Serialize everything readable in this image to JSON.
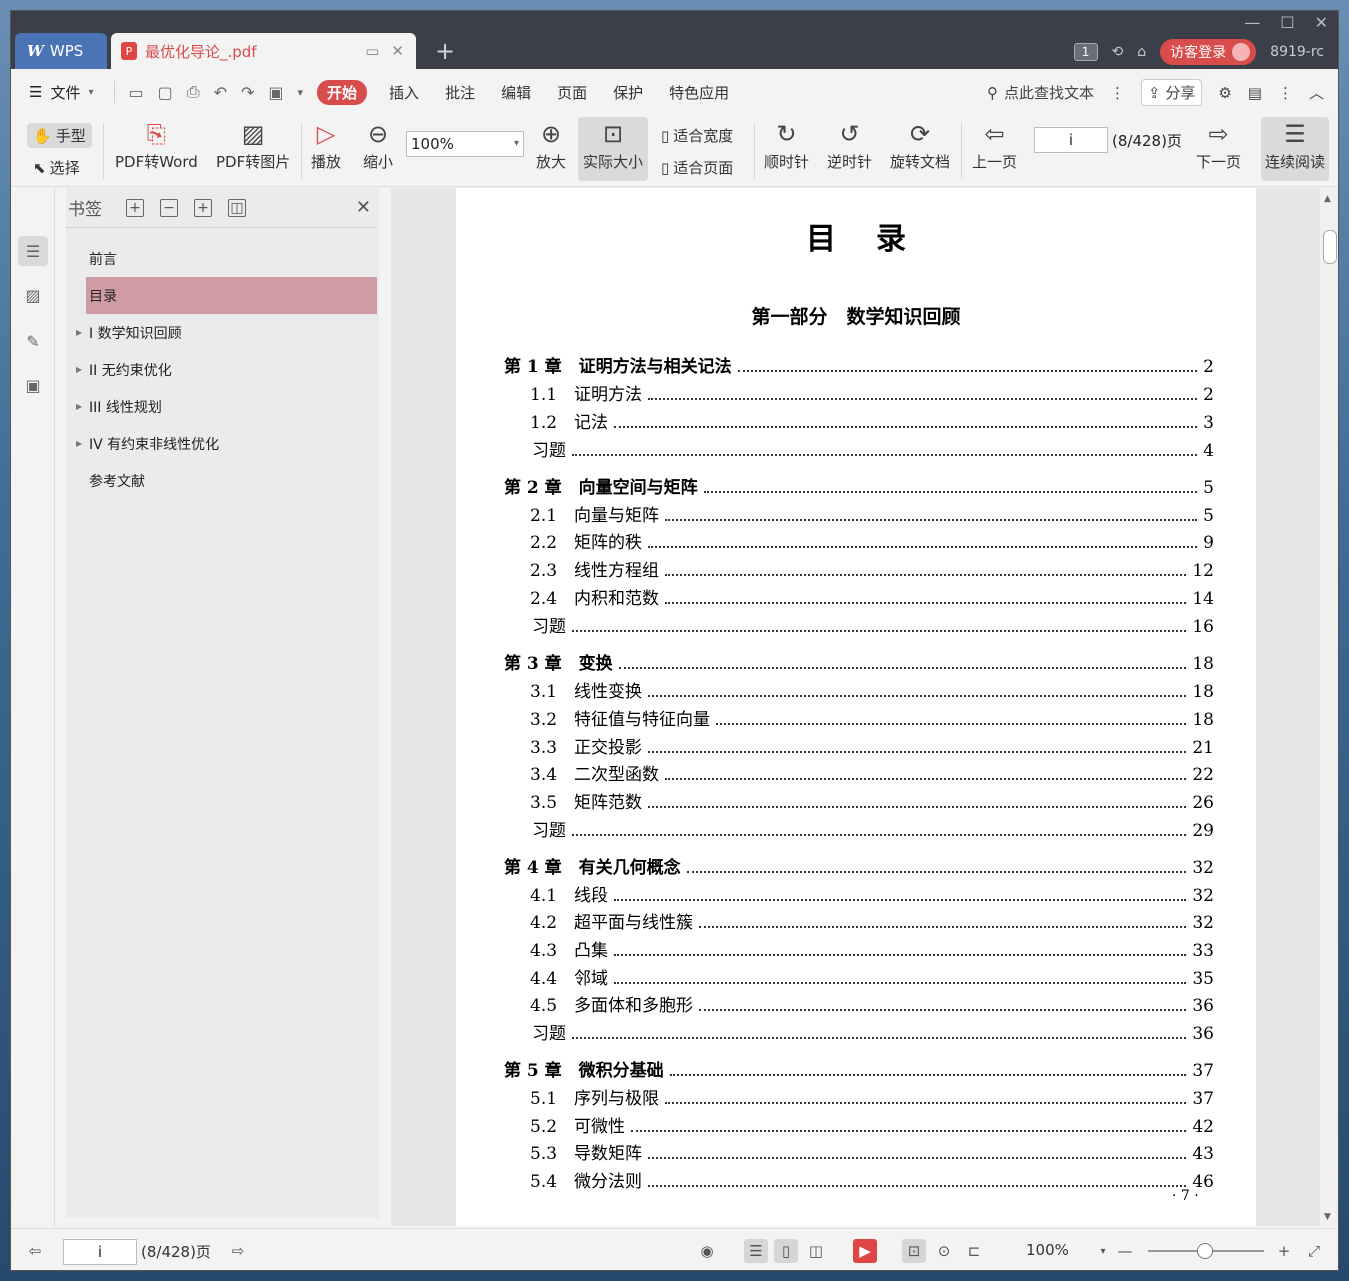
{
  "titlebar": {
    "app_tab": "WPS",
    "doc_tab": "最优化导论_.pdf",
    "new_tab": "+",
    "page_badge": "1",
    "login": "访客登录",
    "user": "8919-rc"
  },
  "menubar": {
    "file": "文件",
    "items": [
      "开始",
      "插入",
      "批注",
      "编辑",
      "页面",
      "保护",
      "特色应用"
    ],
    "search": "点此查找文本",
    "share": "分享"
  },
  "ribbon": {
    "hand": "手型",
    "select": "选择",
    "pdf_to_word": "PDF转Word",
    "pdf_to_image": "PDF转图片",
    "play": "播放",
    "zoom_out": "缩小",
    "zoom_value": "100%",
    "zoom_in": "放大",
    "actual_size": "实际大小",
    "fit_width": "适合宽度",
    "fit_page": "适合页面",
    "clockwise": "顺时针",
    "counterclockwise": "逆时针",
    "rotate_doc": "旋转文档",
    "prev_page": "上一页",
    "page_input": "i",
    "page_count": "(8/428)页",
    "next_page": "下一页",
    "continuous": "连续阅读"
  },
  "bookmarks": {
    "title": "书签",
    "items": [
      {
        "label": "前言"
      },
      {
        "label": "目录"
      },
      {
        "label": "I 数学知识回顾"
      },
      {
        "label": "II 无约束优化"
      },
      {
        "label": "III 线性规划"
      },
      {
        "label": "IV  有约束非线性优化"
      },
      {
        "label": "参考文献"
      }
    ]
  },
  "page": {
    "title": "目录",
    "part": "第一部分　数学知识回顾",
    "page_number": "· 7 ·",
    "toc": [
      {
        "label": "第 1 章　证明方法与相关记法",
        "page": "2"
      },
      {
        "label": "1.1　证明方法",
        "page": "2"
      },
      {
        "label": "1.2　记法",
        "page": "3"
      },
      {
        "label": "习题",
        "page": "4"
      },
      {
        "label": "第 2 章　向量空间与矩阵",
        "page": "5"
      },
      {
        "label": "2.1　向量与矩阵",
        "page": "5"
      },
      {
        "label": "2.2　矩阵的秩",
        "page": "9"
      },
      {
        "label": "2.3　线性方程组",
        "page": "12"
      },
      {
        "label": "2.4　内积和范数",
        "page": "14"
      },
      {
        "label": "习题",
        "page": "16"
      },
      {
        "label": "第 3 章　变换",
        "page": "18"
      },
      {
        "label": "3.1　线性变换",
        "page": "18"
      },
      {
        "label": "3.2　特征值与特征向量",
        "page": "18"
      },
      {
        "label": "3.3　正交投影",
        "page": "21"
      },
      {
        "label": "3.4　二次型函数",
        "page": "22"
      },
      {
        "label": "3.5　矩阵范数",
        "page": "26"
      },
      {
        "label": "习题",
        "page": "29"
      },
      {
        "label": "第 4 章　有关几何概念",
        "page": "32"
      },
      {
        "label": "4.1　线段",
        "page": "32"
      },
      {
        "label": "4.2　超平面与线性簇",
        "page": "32"
      },
      {
        "label": "4.3　凸集",
        "page": "33"
      },
      {
        "label": "4.4　邻域",
        "page": "35"
      },
      {
        "label": "4.5　多面体和多胞形",
        "page": "36"
      },
      {
        "label": "习题",
        "page": "36"
      },
      {
        "label": "第 5 章　微积分基础",
        "page": "37"
      },
      {
        "label": "5.1　序列与极限",
        "page": "37"
      },
      {
        "label": "5.2　可微性",
        "page": "42"
      },
      {
        "label": "5.3　导数矩阵",
        "page": "43"
      },
      {
        "label": "5.4　微分法则",
        "page": "46"
      }
    ]
  },
  "statusbar": {
    "page_input": "i",
    "page_count": "(8/428)页",
    "zoom": "100%",
    "zoom_fraction": 0.42
  }
}
